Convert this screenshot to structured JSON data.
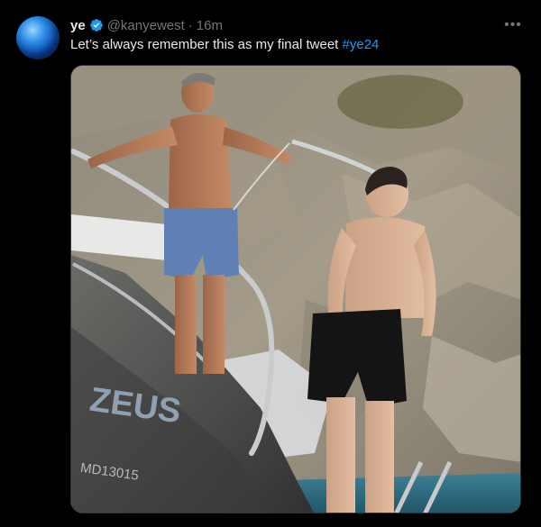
{
  "tweet": {
    "name": "ye",
    "handle": "@kanyewest",
    "separator": "·",
    "time": "16m",
    "text_main": "Let’s always remember this as my final tweet ",
    "hashtag": "#ye24",
    "more_label": "•••",
    "icons": {
      "avatar": "avatar",
      "verified": "verified-badge-icon",
      "more": "more-icon"
    },
    "colors": {
      "background": "#000000",
      "text": "#e7e9ea",
      "muted": "#71767b",
      "link": "#1d9bf0",
      "verified": "#1d9bf0"
    },
    "media": {
      "boat_text": "ZEUS",
      "hull_number": "MD13015"
    }
  }
}
